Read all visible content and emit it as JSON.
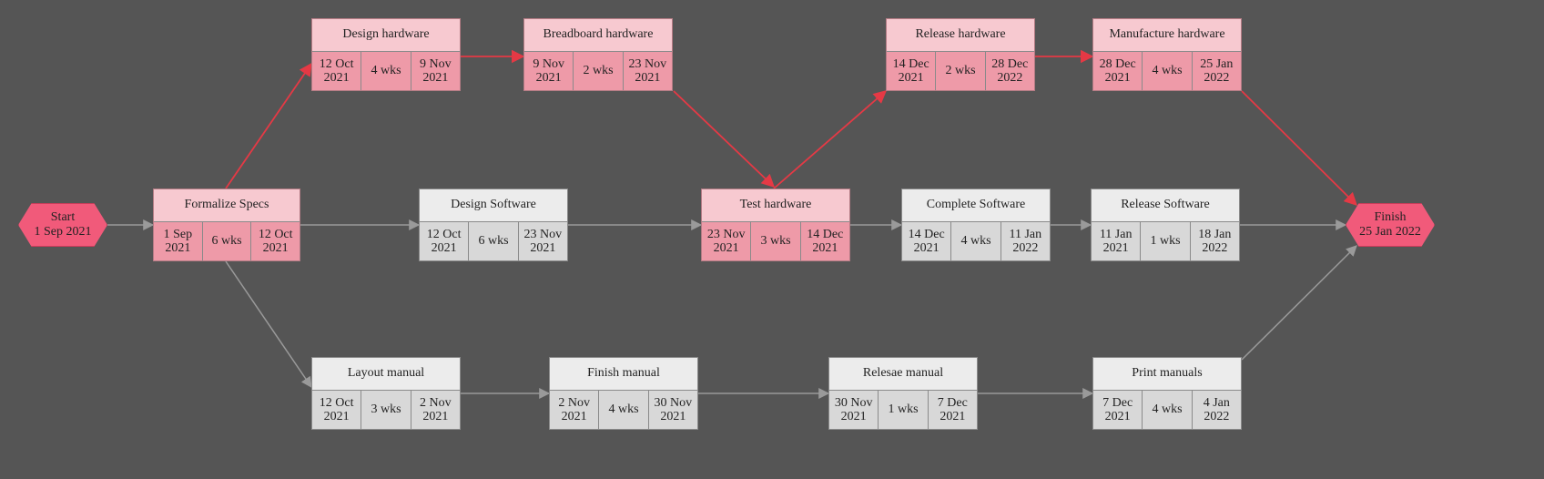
{
  "chart_data": {
    "type": "pert",
    "title": "",
    "start": {
      "label": "Start",
      "date": "1 Sep 2021"
    },
    "finish": {
      "label": "Finish",
      "date": "25 Jan 2022"
    },
    "tasks": [
      {
        "id": "formalize_specs",
        "name": "Formalize Specs",
        "start": "1 Sep 2021",
        "duration": "6 wks",
        "end": "12 Oct 2021",
        "critical": true
      },
      {
        "id": "design_hardware",
        "name": "Design hardware",
        "start": "12 Oct 2021",
        "duration": "4 wks",
        "end": "9 Nov 2021",
        "critical": true
      },
      {
        "id": "breadboard_hardware",
        "name": "Breadboard hardware",
        "start": "9 Nov 2021",
        "duration": "2 wks",
        "end": "23 Nov 2021",
        "critical": true
      },
      {
        "id": "release_hardware",
        "name": "Release hardware",
        "start": "14 Dec 2021",
        "duration": "2 wks",
        "end": "28 Dec 2022",
        "critical": true
      },
      {
        "id": "manufacture_hardware",
        "name": "Manufacture hardware",
        "start": "28 Dec 2021",
        "duration": "4 wks",
        "end": "25 Jan 2022",
        "critical": true
      },
      {
        "id": "design_software",
        "name": "Design Software",
        "start": "12 Oct 2021",
        "duration": "6 wks",
        "end": "23 Nov 2021",
        "critical": false
      },
      {
        "id": "test_hardware",
        "name": "Test hardware",
        "start": "23 Nov 2021",
        "duration": "3 wks",
        "end": "14 Dec 2021",
        "critical": true
      },
      {
        "id": "complete_software",
        "name": "Complete Software",
        "start": "14 Dec 2021",
        "duration": "4 wks",
        "end": "11 Jan 2022",
        "critical": false
      },
      {
        "id": "release_software",
        "name": "Release Software",
        "start": "11 Jan 2021",
        "duration": "1 wks",
        "end": "18 Jan 2022",
        "critical": false
      },
      {
        "id": "layout_manual",
        "name": "Layout manual",
        "start": "12 Oct 2021",
        "duration": "3 wks",
        "end": "2 Nov 2021",
        "critical": false
      },
      {
        "id": "finish_manual",
        "name": "Finish manual",
        "start": "2 Nov 2021",
        "duration": "4 wks",
        "end": "30 Nov 2021",
        "critical": false
      },
      {
        "id": "release_manual",
        "name": "Relesae manual",
        "start": "30 Nov 2021",
        "duration": "1 wks",
        "end": "7 Dec 2021",
        "critical": false
      },
      {
        "id": "print_manuals",
        "name": "Print manuals",
        "start": "7 Dec 2021",
        "duration": "4 wks",
        "end": "4 Jan 2022",
        "critical": false
      }
    ],
    "edges": [
      {
        "from": "start",
        "to": "formalize_specs",
        "critical": false
      },
      {
        "from": "formalize_specs",
        "to": "design_hardware",
        "critical": true
      },
      {
        "from": "formalize_specs",
        "to": "design_software",
        "critical": false
      },
      {
        "from": "formalize_specs",
        "to": "layout_manual",
        "critical": false
      },
      {
        "from": "design_hardware",
        "to": "breadboard_hardware",
        "critical": true
      },
      {
        "from": "breadboard_hardware",
        "to": "test_hardware",
        "critical": true
      },
      {
        "from": "design_software",
        "to": "test_hardware",
        "critical": false
      },
      {
        "from": "test_hardware",
        "to": "release_hardware",
        "critical": true
      },
      {
        "from": "test_hardware",
        "to": "complete_software",
        "critical": false
      },
      {
        "from": "release_hardware",
        "to": "manufacture_hardware",
        "critical": true
      },
      {
        "from": "complete_software",
        "to": "release_software",
        "critical": false
      },
      {
        "from": "layout_manual",
        "to": "finish_manual",
        "critical": false
      },
      {
        "from": "finish_manual",
        "to": "release_manual",
        "critical": false
      },
      {
        "from": "release_manual",
        "to": "print_manuals",
        "critical": false
      },
      {
        "from": "manufacture_hardware",
        "to": "finish",
        "critical": true
      },
      {
        "from": "release_software",
        "to": "finish",
        "critical": false
      },
      {
        "from": "print_manuals",
        "to": "finish",
        "critical": false
      }
    ]
  },
  "colors": {
    "critical_edge": "#e53945",
    "normal_edge": "#9a9a9a",
    "critical_fill_header": "#f7c9d0",
    "critical_fill_body": "#ee9aa8",
    "normal_fill_header": "#ececec",
    "normal_fill_body": "#d8d8d8"
  }
}
